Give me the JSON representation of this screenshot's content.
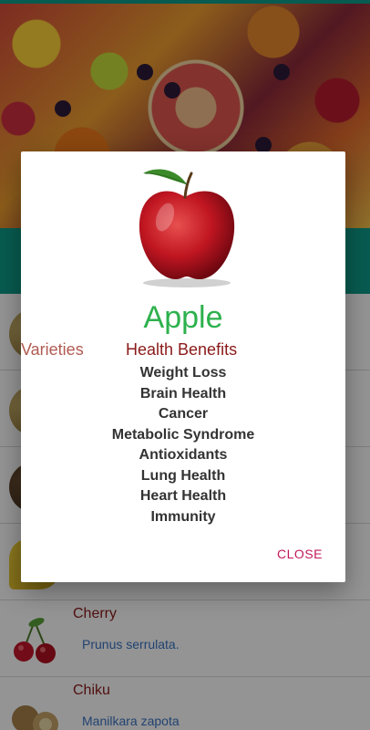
{
  "list": {
    "items": [
      {
        "name": "",
        "scientific": ""
      },
      {
        "name": "",
        "scientific": ""
      },
      {
        "name": "",
        "scientific": ""
      },
      {
        "name": "",
        "scientific": ""
      },
      {
        "name": "Cherry",
        "scientific": "Prunus serrulata."
      },
      {
        "name": "Chiku",
        "scientific": "Manilkara zapota"
      }
    ]
  },
  "dialog": {
    "title": "Apple",
    "tabs": {
      "varieties": "Varieties",
      "health_benefits": "Health Benefits"
    },
    "benefits": [
      "Weight Loss",
      "Brain Health",
      "Cancer",
      "Metabolic Syndrome",
      "Antioxidants",
      "Lung Health",
      "Heart Health",
      "Immunity"
    ],
    "close_label": "CLOSE"
  },
  "colors": {
    "teal": "#0f9d8a",
    "title_green": "#2db14d",
    "maroon": "#8b1a1a",
    "close_pink": "#c2185b",
    "scientific_blue": "#3a73c2"
  }
}
